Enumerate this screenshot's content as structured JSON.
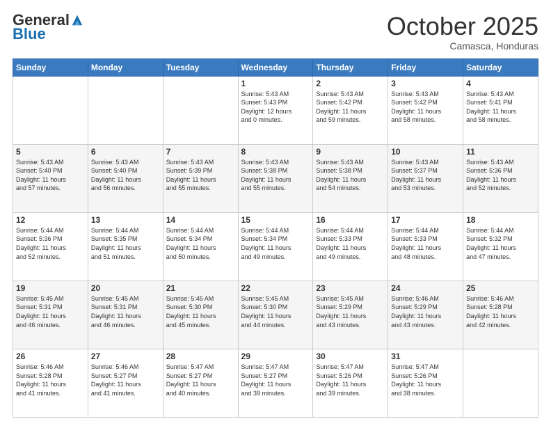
{
  "logo": {
    "general": "General",
    "blue": "Blue"
  },
  "header": {
    "month": "October 2025",
    "location": "Camasca, Honduras"
  },
  "days_of_week": [
    "Sunday",
    "Monday",
    "Tuesday",
    "Wednesday",
    "Thursday",
    "Friday",
    "Saturday"
  ],
  "weeks": [
    [
      {
        "num": "",
        "info": ""
      },
      {
        "num": "",
        "info": ""
      },
      {
        "num": "",
        "info": ""
      },
      {
        "num": "1",
        "info": "Sunrise: 5:43 AM\nSunset: 5:43 PM\nDaylight: 12 hours\nand 0 minutes."
      },
      {
        "num": "2",
        "info": "Sunrise: 5:43 AM\nSunset: 5:42 PM\nDaylight: 11 hours\nand 59 minutes."
      },
      {
        "num": "3",
        "info": "Sunrise: 5:43 AM\nSunset: 5:42 PM\nDaylight: 11 hours\nand 58 minutes."
      },
      {
        "num": "4",
        "info": "Sunrise: 5:43 AM\nSunset: 5:41 PM\nDaylight: 11 hours\nand 58 minutes."
      }
    ],
    [
      {
        "num": "5",
        "info": "Sunrise: 5:43 AM\nSunset: 5:40 PM\nDaylight: 11 hours\nand 57 minutes."
      },
      {
        "num": "6",
        "info": "Sunrise: 5:43 AM\nSunset: 5:40 PM\nDaylight: 11 hours\nand 56 minutes."
      },
      {
        "num": "7",
        "info": "Sunrise: 5:43 AM\nSunset: 5:39 PM\nDaylight: 11 hours\nand 55 minutes."
      },
      {
        "num": "8",
        "info": "Sunrise: 5:43 AM\nSunset: 5:38 PM\nDaylight: 11 hours\nand 55 minutes."
      },
      {
        "num": "9",
        "info": "Sunrise: 5:43 AM\nSunset: 5:38 PM\nDaylight: 11 hours\nand 54 minutes."
      },
      {
        "num": "10",
        "info": "Sunrise: 5:43 AM\nSunset: 5:37 PM\nDaylight: 11 hours\nand 53 minutes."
      },
      {
        "num": "11",
        "info": "Sunrise: 5:43 AM\nSunset: 5:36 PM\nDaylight: 11 hours\nand 52 minutes."
      }
    ],
    [
      {
        "num": "12",
        "info": "Sunrise: 5:44 AM\nSunset: 5:36 PM\nDaylight: 11 hours\nand 52 minutes."
      },
      {
        "num": "13",
        "info": "Sunrise: 5:44 AM\nSunset: 5:35 PM\nDaylight: 11 hours\nand 51 minutes."
      },
      {
        "num": "14",
        "info": "Sunrise: 5:44 AM\nSunset: 5:34 PM\nDaylight: 11 hours\nand 50 minutes."
      },
      {
        "num": "15",
        "info": "Sunrise: 5:44 AM\nSunset: 5:34 PM\nDaylight: 11 hours\nand 49 minutes."
      },
      {
        "num": "16",
        "info": "Sunrise: 5:44 AM\nSunset: 5:33 PM\nDaylight: 11 hours\nand 49 minutes."
      },
      {
        "num": "17",
        "info": "Sunrise: 5:44 AM\nSunset: 5:33 PM\nDaylight: 11 hours\nand 48 minutes."
      },
      {
        "num": "18",
        "info": "Sunrise: 5:44 AM\nSunset: 5:32 PM\nDaylight: 11 hours\nand 47 minutes."
      }
    ],
    [
      {
        "num": "19",
        "info": "Sunrise: 5:45 AM\nSunset: 5:31 PM\nDaylight: 11 hours\nand 46 minutes."
      },
      {
        "num": "20",
        "info": "Sunrise: 5:45 AM\nSunset: 5:31 PM\nDaylight: 11 hours\nand 46 minutes."
      },
      {
        "num": "21",
        "info": "Sunrise: 5:45 AM\nSunset: 5:30 PM\nDaylight: 11 hours\nand 45 minutes."
      },
      {
        "num": "22",
        "info": "Sunrise: 5:45 AM\nSunset: 5:30 PM\nDaylight: 11 hours\nand 44 minutes."
      },
      {
        "num": "23",
        "info": "Sunrise: 5:45 AM\nSunset: 5:29 PM\nDaylight: 11 hours\nand 43 minutes."
      },
      {
        "num": "24",
        "info": "Sunrise: 5:46 AM\nSunset: 5:29 PM\nDaylight: 11 hours\nand 43 minutes."
      },
      {
        "num": "25",
        "info": "Sunrise: 5:46 AM\nSunset: 5:28 PM\nDaylight: 11 hours\nand 42 minutes."
      }
    ],
    [
      {
        "num": "26",
        "info": "Sunrise: 5:46 AM\nSunset: 5:28 PM\nDaylight: 11 hours\nand 41 minutes."
      },
      {
        "num": "27",
        "info": "Sunrise: 5:46 AM\nSunset: 5:27 PM\nDaylight: 11 hours\nand 41 minutes."
      },
      {
        "num": "28",
        "info": "Sunrise: 5:47 AM\nSunset: 5:27 PM\nDaylight: 11 hours\nand 40 minutes."
      },
      {
        "num": "29",
        "info": "Sunrise: 5:47 AM\nSunset: 5:27 PM\nDaylight: 11 hours\nand 39 minutes."
      },
      {
        "num": "30",
        "info": "Sunrise: 5:47 AM\nSunset: 5:26 PM\nDaylight: 11 hours\nand 39 minutes."
      },
      {
        "num": "31",
        "info": "Sunrise: 5:47 AM\nSunset: 5:26 PM\nDaylight: 11 hours\nand 38 minutes."
      },
      {
        "num": "",
        "info": ""
      }
    ]
  ]
}
